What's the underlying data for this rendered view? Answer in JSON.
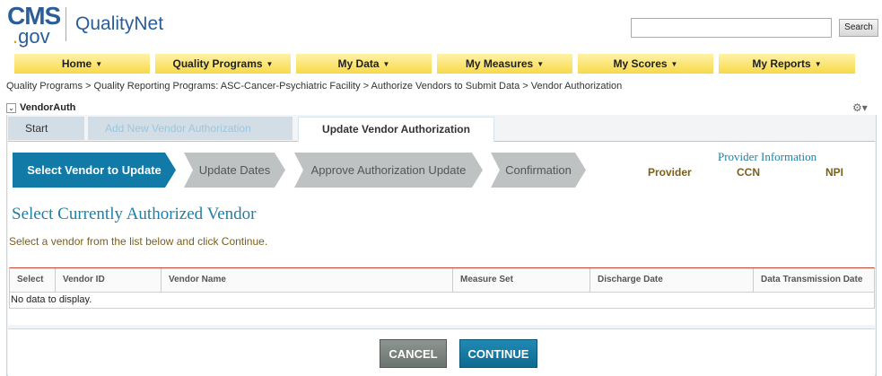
{
  "header": {
    "logo_cms": "CMS",
    "logo_gov": "gov",
    "logo_qualitynet": "QualityNet",
    "search_value": "",
    "search_button": "Search"
  },
  "topnav": {
    "items": [
      {
        "label": "Home"
      },
      {
        "label": "Quality Programs"
      },
      {
        "label": "My Data"
      },
      {
        "label": "My Measures"
      },
      {
        "label": "My Scores"
      },
      {
        "label": "My Reports"
      }
    ]
  },
  "breadcrumb": "Quality Programs > Quality Reporting Programs: ASC-Cancer-Psychiatric Facility > Authorize Vendors to Submit Data > Vendor Authorization",
  "portlet": {
    "title": "VendorAuth"
  },
  "tabs": {
    "start": "Start",
    "add": "Add New Vendor Authorization",
    "update": "Update Vendor Authorization"
  },
  "steps": [
    {
      "label": "Select Vendor to Update",
      "active": true
    },
    {
      "label": "Update Dates",
      "active": false
    },
    {
      "label": "Approve Authorization Update",
      "active": false
    },
    {
      "label": "Confirmation",
      "active": false
    }
  ],
  "provider_info": {
    "title": "Provider Information",
    "provider": "Provider",
    "ccn": "CCN",
    "npi": "NPI"
  },
  "section": {
    "title": "Select Currently Authorized Vendor",
    "instructions": "Select a vendor from the list below and click Continue."
  },
  "table": {
    "columns": [
      "Select",
      "Vendor ID",
      "Vendor Name",
      "Measure Set",
      "Discharge Date",
      "Data Transmission Date"
    ],
    "empty_text": "No data to display."
  },
  "buttons": {
    "cancel": "CANCEL",
    "continue": "CONTINUE"
  },
  "colors": {
    "brand_blue": "#2b5d99",
    "nav_yellow": "#f7d94a",
    "active_step": "#117aa6",
    "heading_teal": "#1f7fa6",
    "label_brown": "#7a5f1a"
  }
}
